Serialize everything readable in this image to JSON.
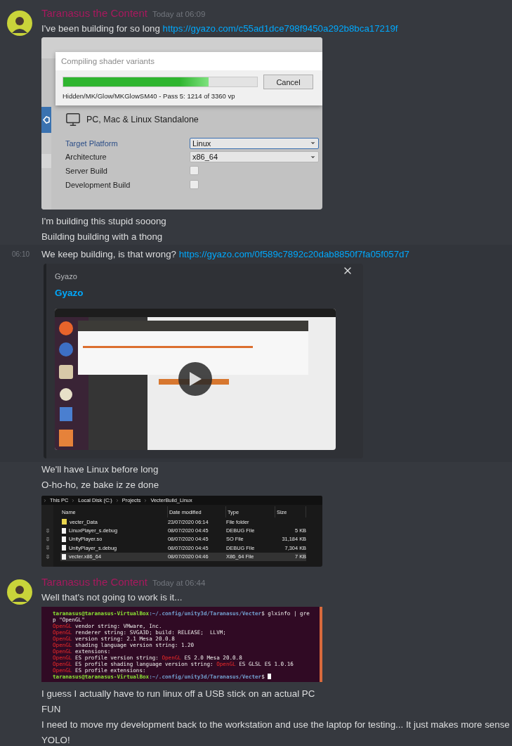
{
  "items": [
    {
      "kind": "header",
      "author": "Taranasus the Content",
      "timestamp": "Today at 06:09",
      "text": "I've been building for so long",
      "link": "https://gyazo.com/c55ad1dce798f9450a292b8bca17219f"
    },
    {
      "kind": "unity_shot",
      "dialog_title": "Compiling shader variants",
      "progress": {
        "level": 0.75
      },
      "cancel": "Cancel",
      "status": "Hidden/MK/Glow/MKGlowSM40 - Pass 5: 1214 of 3360 vp",
      "platform": "PC, Mac & Linux Standalone",
      "settings": [
        {
          "kind": "dropdown",
          "label": "Target Platform",
          "value": "Linux",
          "selected": true
        },
        {
          "kind": "dropdown",
          "label": "Architecture",
          "value": "x86_64",
          "selected": false
        },
        {
          "kind": "checkbox",
          "label": "Server Build",
          "checked": false
        },
        {
          "kind": "checkbox",
          "label": "Development Build",
          "checked": false
        }
      ]
    },
    {
      "kind": "line",
      "hovered": false,
      "text": "I'm building this stupid sooong"
    },
    {
      "kind": "line",
      "hovered": false,
      "text": "Building building with a thong"
    },
    {
      "kind": "line",
      "hovered": true,
      "time": "06:10",
      "text": "We keep building, is that wrong?",
      "link": "https://gyazo.com/0f589c7892c20dab8850f7fa05f057d7",
      "embed": {
        "provider": "Gyazo",
        "title": "Gyazo"
      }
    },
    {
      "kind": "line",
      "hovered": false,
      "text": "We'll have Linux before long"
    },
    {
      "kind": "line",
      "hovered": false,
      "text": "O-ho-ho, ze bake iz ze done"
    },
    {
      "kind": "explorer_shot",
      "breadcrumb": [
        "This PC",
        "Local Disk (C:)",
        "Projects",
        "VecterBuild_Linux"
      ],
      "columns": [
        "Name",
        "Date modified",
        "Type",
        "Size"
      ],
      "rows": [
        {
          "kind": "folder",
          "name": "vecter_Data",
          "date": "23/07/2020 06:14",
          "type": "File folder",
          "pinned": false,
          "selected": false
        },
        {
          "kind": "file",
          "name": "LinuxPlayer_s.debug",
          "date": "08/07/2020 04:45",
          "type": "DEBUG File",
          "size": "5 KB",
          "pinned": true,
          "selected": false
        },
        {
          "kind": "file",
          "name": "UnityPlayer.so",
          "date": "08/07/2020 04:45",
          "type": "SO File",
          "size": "31,184 KB",
          "pinned": true,
          "selected": false
        },
        {
          "kind": "file",
          "name": "UnityPlayer_s.debug",
          "date": "08/07/2020 04:45",
          "type": "DEBUG File",
          "size": "7,304 KB",
          "pinned": true,
          "selected": false
        },
        {
          "kind": "file",
          "name": "vecter.x86_64",
          "date": "08/07/2020 04:46",
          "type": "X86_64 File",
          "size": "7 KB",
          "pinned": true,
          "selected": true
        }
      ]
    },
    {
      "kind": "header",
      "author": "Taranasus the Content",
      "timestamp": "Today at 06:44",
      "text": "Well that's not going to work is it..."
    },
    {
      "kind": "terminal_shot",
      "lines": [
        {
          "cursor": false,
          "segments": [
            {
              "kind": "user",
              "text": "taranasus@taranasus-VirtualBox"
            },
            {
              "kind": "path",
              "text": ":~/.config/unity3d/Taranasus/Vecter"
            },
            {
              "kind": "plain",
              "text": "$ glxinfo | gre"
            }
          ]
        },
        {
          "cursor": false,
          "segments": [
            {
              "kind": "plain",
              "text": "p \"OpenGL\""
            }
          ]
        },
        {
          "cursor": false,
          "segments": [
            {
              "kind": "match",
              "text": "OpenGL"
            },
            {
              "kind": "plain",
              "text": " vendor string: VMware, Inc."
            }
          ]
        },
        {
          "cursor": false,
          "segments": [
            {
              "kind": "match",
              "text": "OpenGL"
            },
            {
              "kind": "plain",
              "text": " renderer string: SVGA3D; build: RELEASE;  LLVM;"
            }
          ]
        },
        {
          "cursor": false,
          "segments": [
            {
              "kind": "match",
              "text": "OpenGL"
            },
            {
              "kind": "plain",
              "text": " version string: 2.1 Mesa 20.0.8"
            }
          ]
        },
        {
          "cursor": false,
          "segments": [
            {
              "kind": "match",
              "text": "OpenGL"
            },
            {
              "kind": "plain",
              "text": " shading language version string: 1.20"
            }
          ]
        },
        {
          "cursor": false,
          "segments": [
            {
              "kind": "match",
              "text": "OpenGL"
            },
            {
              "kind": "plain",
              "text": " extensions:"
            }
          ]
        },
        {
          "cursor": false,
          "segments": [
            {
              "kind": "match",
              "text": "OpenGL"
            },
            {
              "kind": "plain",
              "text": " ES profile version string: "
            },
            {
              "kind": "match",
              "text": "OpenGL"
            },
            {
              "kind": "plain",
              "text": " ES 2.0 Mesa 20.0.8"
            }
          ]
        },
        {
          "cursor": false,
          "segments": [
            {
              "kind": "match",
              "text": "OpenGL"
            },
            {
              "kind": "plain",
              "text": " ES profile shading language version string: "
            },
            {
              "kind": "match",
              "text": "OpenGL"
            },
            {
              "kind": "plain",
              "text": " ES GLSL ES 1.0.16"
            }
          ]
        },
        {
          "cursor": false,
          "segments": [
            {
              "kind": "match",
              "text": "OpenGL"
            },
            {
              "kind": "plain",
              "text": " ES profile extensions:"
            }
          ]
        },
        {
          "cursor": true,
          "segments": [
            {
              "kind": "user",
              "text": "taranasus@taranasus-VirtualBox"
            },
            {
              "kind": "path",
              "text": ":~/.config/unity3d/Taranasus/Vecter"
            },
            {
              "kind": "plain",
              "text": "$ "
            }
          ]
        }
      ]
    },
    {
      "kind": "line",
      "hovered": false,
      "text": "I guess I actually have to run linux off a USB stick on an actual PC"
    },
    {
      "kind": "line",
      "hovered": false,
      "text": "FUN"
    },
    {
      "kind": "line",
      "hovered": false,
      "text": "I need to move my development back to the workstation and use the laptop for testing... It just makes more sense"
    },
    {
      "kind": "line",
      "hovered": false,
      "text": "YOLO!"
    }
  ]
}
